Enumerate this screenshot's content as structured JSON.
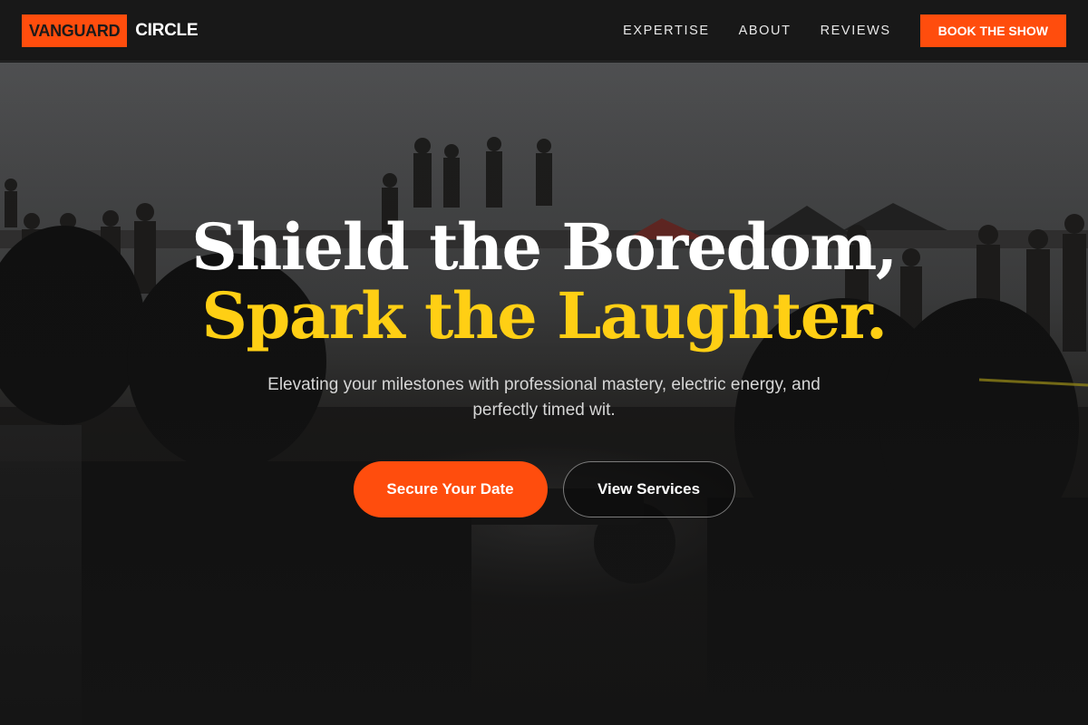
{
  "brand": {
    "highlight": "VANGUARD",
    "name": "CIRCLE",
    "accent_color": "#ff4d0d"
  },
  "nav": {
    "links": [
      "EXPERTISE",
      "ABOUT",
      "REVIEWS"
    ],
    "cta_label": "BOOK THE SHOW"
  },
  "hero": {
    "headline_line1": "Shield the Boredom,",
    "headline_line2": "Spark the Laughter.",
    "headline_highlight_color": "#ffcf14",
    "subtitle": "Elevating your milestones with professional mastery, electric energy, and perfectly timed wit.",
    "primary_button": "Secure Your Date",
    "secondary_button": "View Services",
    "background_description_icon": "crowd-photo"
  }
}
